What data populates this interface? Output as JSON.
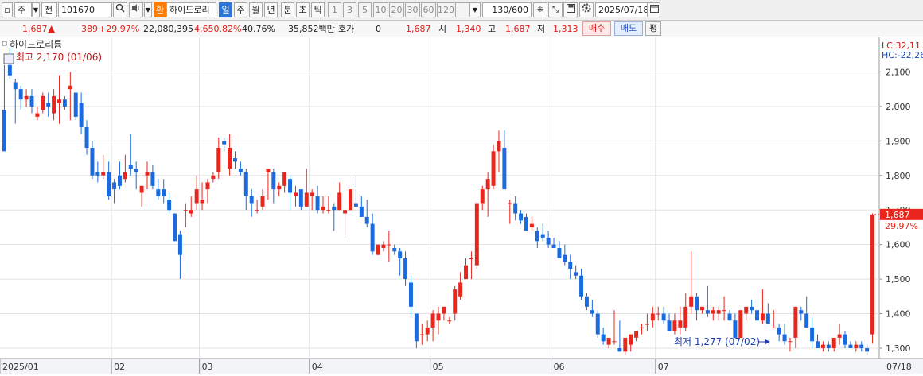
{
  "toolbar": {
    "market_label": "주",
    "exchange_label": "전",
    "code": "101670",
    "stock_name_tag": "환",
    "stock_name": "하이드로리",
    "periods": [
      "일",
      "주",
      "월",
      "년",
      "분",
      "초",
      "틱"
    ],
    "active_period": "일",
    "numbers": [
      "1",
      "3",
      "5",
      "10",
      "20",
      "30",
      "60",
      "120"
    ],
    "count": "130/600",
    "date": "2025/07/18",
    "icons": [
      "search-icon",
      "speaker-icon",
      "chevron-down-icon",
      "calendar-icon",
      "gear-icon",
      "save-icon",
      "settings-icon"
    ]
  },
  "info": {
    "price": "1,687",
    "arrow": "🡅",
    "change": "389",
    "change_rate": "+29.97%",
    "volume": "22,080,395",
    "volume_rate": "4,650.82%",
    "turnover": "40.76%",
    "amount": "35,852백만",
    "quote_label": "호가",
    "quote_value": "0",
    "quote_price": "1,687",
    "open_label": "시",
    "open": "1,340",
    "high_label": "고",
    "high": "1,687",
    "low_label": "저",
    "low": "1,313",
    "buy_label": "매수",
    "sell_label": "매도",
    "eval_label": "평"
  },
  "chart": {
    "stock_label": "하이드로리튬",
    "max_annotation": "최고 2,170 (01/06)",
    "min_annotation": "최저 1,277 (07/02)",
    "lc_label": "LC:32,11",
    "hc_label": "HC:-22,26",
    "current_price_tag": "1,687",
    "current_rate_tag": "29.97%"
  },
  "chart_data": {
    "type": "candlestick",
    "y_ticks": [
      "2,100",
      "2,000",
      "1,900",
      "1,800",
      "1,700",
      "1,600",
      "1,500",
      "1,400",
      "1,300"
    ],
    "y_tick_values": [
      2100,
      2000,
      1900,
      1800,
      1700,
      1600,
      1500,
      1400,
      1300
    ],
    "x_labels": [
      "2025/01",
      "02",
      "03",
      "04",
      "05",
      "06",
      "07",
      "07/18"
    ],
    "ylim": [
      1270,
      2200
    ],
    "colors": {
      "up": "#e8261e",
      "down": "#1a6be0",
      "accent": "#2e74d6"
    },
    "candles": [
      [
        1990,
        2120,
        1980,
        1870
      ],
      [
        2120,
        2170,
        2080,
        2090
      ],
      [
        2070,
        2080,
        1950,
        2050
      ],
      [
        2050,
        2060,
        1990,
        2020
      ],
      [
        2020,
        2050,
        2000,
        2030
      ],
      [
        2030,
        2050,
        1980,
        2000
      ],
      [
        1970,
        2000,
        1960,
        1980
      ],
      [
        1990,
        2040,
        1980,
        2030
      ],
      [
        2010,
        2040,
        1970,
        2000
      ],
      [
        1980,
        2050,
        1960,
        2030
      ],
      [
        2010,
        2090,
        1950,
        2020
      ],
      [
        2020,
        2030,
        1990,
        2000
      ],
      [
        2050,
        2100,
        1960,
        2060
      ],
      [
        2040,
        2040,
        1960,
        1970
      ],
      [
        2010,
        2040,
        1920,
        1940
      ],
      [
        1940,
        1960,
        1860,
        1880
      ],
      [
        1880,
        1900,
        1790,
        1800
      ],
      [
        1810,
        1840,
        1780,
        1800
      ],
      [
        1800,
        1860,
        1790,
        1810
      ],
      [
        1810,
        1840,
        1730,
        1740
      ],
      [
        1780,
        1790,
        1720,
        1760
      ],
      [
        1800,
        1840,
        1760,
        1770
      ],
      [
        1790,
        1860,
        1780,
        1810
      ],
      [
        1830,
        1920,
        1800,
        1820
      ],
      [
        1820,
        1840,
        1760,
        1810
      ],
      [
        1750,
        1770,
        1710,
        1770
      ],
      [
        1800,
        1840,
        1760,
        1810
      ],
      [
        1810,
        1830,
        1760,
        1770
      ],
      [
        1760,
        1790,
        1730,
        1740
      ],
      [
        1760,
        1790,
        1720,
        1740
      ],
      [
        1730,
        1750,
        1690,
        1700
      ],
      [
        1690,
        1690,
        1610,
        1610
      ],
      [
        1630,
        1640,
        1500,
        1570
      ],
      [
        1700,
        1720,
        1650,
        1700
      ],
      [
        1690,
        1740,
        1680,
        1700
      ],
      [
        1720,
        1800,
        1700,
        1760
      ],
      [
        1720,
        1780,
        1700,
        1730
      ],
      [
        1760,
        1790,
        1720,
        1780
      ],
      [
        1790,
        1810,
        1780,
        1800
      ],
      [
        1810,
        1910,
        1790,
        1880
      ],
      [
        1900,
        1910,
        1870,
        1890
      ],
      [
        1820,
        1920,
        1800,
        1880
      ],
      [
        1850,
        1870,
        1820,
        1840
      ],
      [
        1820,
        1840,
        1800,
        1810
      ],
      [
        1810,
        1820,
        1700,
        1740
      ],
      [
        1740,
        1760,
        1680,
        1720
      ],
      [
        1700,
        1730,
        1690,
        1700
      ],
      [
        1710,
        1760,
        1700,
        1740
      ],
      [
        1810,
        1820,
        1730,
        1820
      ],
      [
        1810,
        1820,
        1720,
        1760
      ],
      [
        1760,
        1780,
        1740,
        1770
      ],
      [
        1770,
        1800,
        1750,
        1810
      ],
      [
        1790,
        1800,
        1700,
        1750
      ],
      [
        1740,
        1770,
        1710,
        1750
      ],
      [
        1760,
        1760,
        1700,
        1710
      ],
      [
        1710,
        1820,
        1710,
        1750
      ],
      [
        1740,
        1760,
        1700,
        1750
      ],
      [
        1740,
        1770,
        1690,
        1700
      ],
      [
        1700,
        1740,
        1690,
        1710
      ],
      [
        1700,
        1740,
        1690,
        1700
      ],
      [
        1710,
        1720,
        1640,
        1700
      ],
      [
        1700,
        1780,
        1700,
        1750
      ],
      [
        1690,
        1700,
        1620,
        1700
      ],
      [
        1700,
        1760,
        1700,
        1760
      ],
      [
        1720,
        1800,
        1710,
        1710
      ],
      [
        1710,
        1740,
        1680,
        1680
      ],
      [
        1680,
        1730,
        1650,
        1660
      ],
      [
        1660,
        1690,
        1570,
        1580
      ],
      [
        1570,
        1600,
        1570,
        1600
      ],
      [
        1590,
        1610,
        1580,
        1600
      ],
      [
        1600,
        1640,
        1550,
        1600
      ],
      [
        1590,
        1600,
        1570,
        1580
      ],
      [
        1580,
        1590,
        1510,
        1560
      ],
      [
        1560,
        1580,
        1480,
        1500
      ],
      [
        1490,
        1510,
        1390,
        1420
      ],
      [
        1400,
        1400,
        1300,
        1320
      ],
      [
        1340,
        1370,
        1310,
        1340
      ],
      [
        1340,
        1380,
        1320,
        1360
      ],
      [
        1360,
        1410,
        1320,
        1400
      ],
      [
        1380,
        1420,
        1340,
        1400
      ],
      [
        1400,
        1420,
        1380,
        1420
      ],
      [
        1380,
        1390,
        1370,
        1380
      ],
      [
        1400,
        1480,
        1380,
        1470
      ],
      [
        1450,
        1520,
        1440,
        1490
      ],
      [
        1500,
        1560,
        1500,
        1540
      ],
      [
        1560,
        1580,
        1500,
        1560
      ],
      [
        1540,
        1620,
        1530,
        1720
      ],
      [
        1720,
        1770,
        1700,
        1760
      ],
      [
        1760,
        1810,
        1680,
        1790
      ],
      [
        1770,
        1890,
        1760,
        1870
      ],
      [
        1870,
        1930,
        1810,
        1900
      ],
      [
        1880,
        1930,
        1770,
        1760
      ],
      [
        1720,
        1730,
        1660,
        1720
      ],
      [
        1720,
        1740,
        1670,
        1690
      ],
      [
        1690,
        1700,
        1660,
        1670
      ],
      [
        1680,
        1690,
        1640,
        1640
      ],
      [
        1650,
        1680,
        1640,
        1660
      ],
      [
        1640,
        1650,
        1590,
        1610
      ],
      [
        1630,
        1660,
        1610,
        1620
      ],
      [
        1620,
        1640,
        1590,
        1600
      ],
      [
        1600,
        1620,
        1590,
        1590
      ],
      [
        1590,
        1610,
        1560,
        1560
      ],
      [
        1570,
        1600,
        1540,
        1550
      ],
      [
        1550,
        1570,
        1500,
        1530
      ],
      [
        1520,
        1540,
        1500,
        1510
      ],
      [
        1510,
        1530,
        1440,
        1450
      ],
      [
        1450,
        1460,
        1410,
        1420
      ],
      [
        1410,
        1440,
        1390,
        1400
      ],
      [
        1400,
        1410,
        1330,
        1340
      ],
      [
        1340,
        1360,
        1310,
        1320
      ],
      [
        1310,
        1330,
        1300,
        1330
      ],
      [
        1320,
        1410,
        1310,
        1320
      ],
      [
        1300,
        1380,
        1290,
        1290
      ],
      [
        1290,
        1300,
        1280,
        1330
      ],
      [
        1310,
        1340,
        1290,
        1340
      ],
      [
        1330,
        1350,
        1320,
        1350
      ],
      [
        1360,
        1370,
        1340,
        1360
      ],
      [
        1370,
        1400,
        1350,
        1370
      ],
      [
        1380,
        1420,
        1360,
        1400
      ],
      [
        1400,
        1420,
        1380,
        1400
      ],
      [
        1400,
        1420,
        1370,
        1380
      ],
      [
        1380,
        1400,
        1350,
        1350
      ],
      [
        1350,
        1400,
        1340,
        1380
      ],
      [
        1360,
        1420,
        1340,
        1380
      ],
      [
        1360,
        1460,
        1350,
        1420
      ],
      [
        1420,
        1580,
        1400,
        1450
      ],
      [
        1450,
        1460,
        1380,
        1410
      ],
      [
        1410,
        1420,
        1400,
        1420
      ],
      [
        1410,
        1480,
        1390,
        1400
      ],
      [
        1400,
        1420,
        1380,
        1410
      ],
      [
        1400,
        1420,
        1380,
        1410
      ],
      [
        1410,
        1450,
        1380,
        1410
      ],
      [
        1400,
        1410,
        1380,
        1380
      ],
      [
        1380,
        1400,
        1370,
        1330
      ],
      [
        1330,
        1380,
        1330,
        1410
      ],
      [
        1400,
        1420,
        1380,
        1420
      ],
      [
        1420,
        1440,
        1400,
        1410
      ],
      [
        1410,
        1460,
        1390,
        1380
      ],
      [
        1380,
        1470,
        1370,
        1400
      ],
      [
        1400,
        1430,
        1380,
        1370
      ],
      [
        1360,
        1410,
        1360,
        1360
      ],
      [
        1360,
        1370,
        1320,
        1340
      ],
      [
        1340,
        1370,
        1310,
        1320
      ],
      [
        1320,
        1330,
        1290,
        1320
      ],
      [
        1330,
        1420,
        1300,
        1420
      ],
      [
        1410,
        1420,
        1380,
        1400
      ],
      [
        1400,
        1450,
        1360,
        1360
      ],
      [
        1360,
        1390,
        1300,
        1320
      ],
      [
        1320,
        1340,
        1300,
        1300
      ],
      [
        1300,
        1320,
        1290,
        1310
      ],
      [
        1310,
        1320,
        1290,
        1300
      ],
      [
        1300,
        1320,
        1290,
        1330
      ],
      [
        1330,
        1370,
        1310,
        1340
      ],
      [
        1340,
        1350,
        1300,
        1310
      ],
      [
        1310,
        1320,
        1300,
        1300
      ],
      [
        1300,
        1320,
        1290,
        1310
      ],
      [
        1310,
        1320,
        1290,
        1300
      ],
      [
        1300,
        1310,
        1280,
        1290
      ],
      [
        1340,
        1690,
        1313,
        1687
      ]
    ]
  }
}
